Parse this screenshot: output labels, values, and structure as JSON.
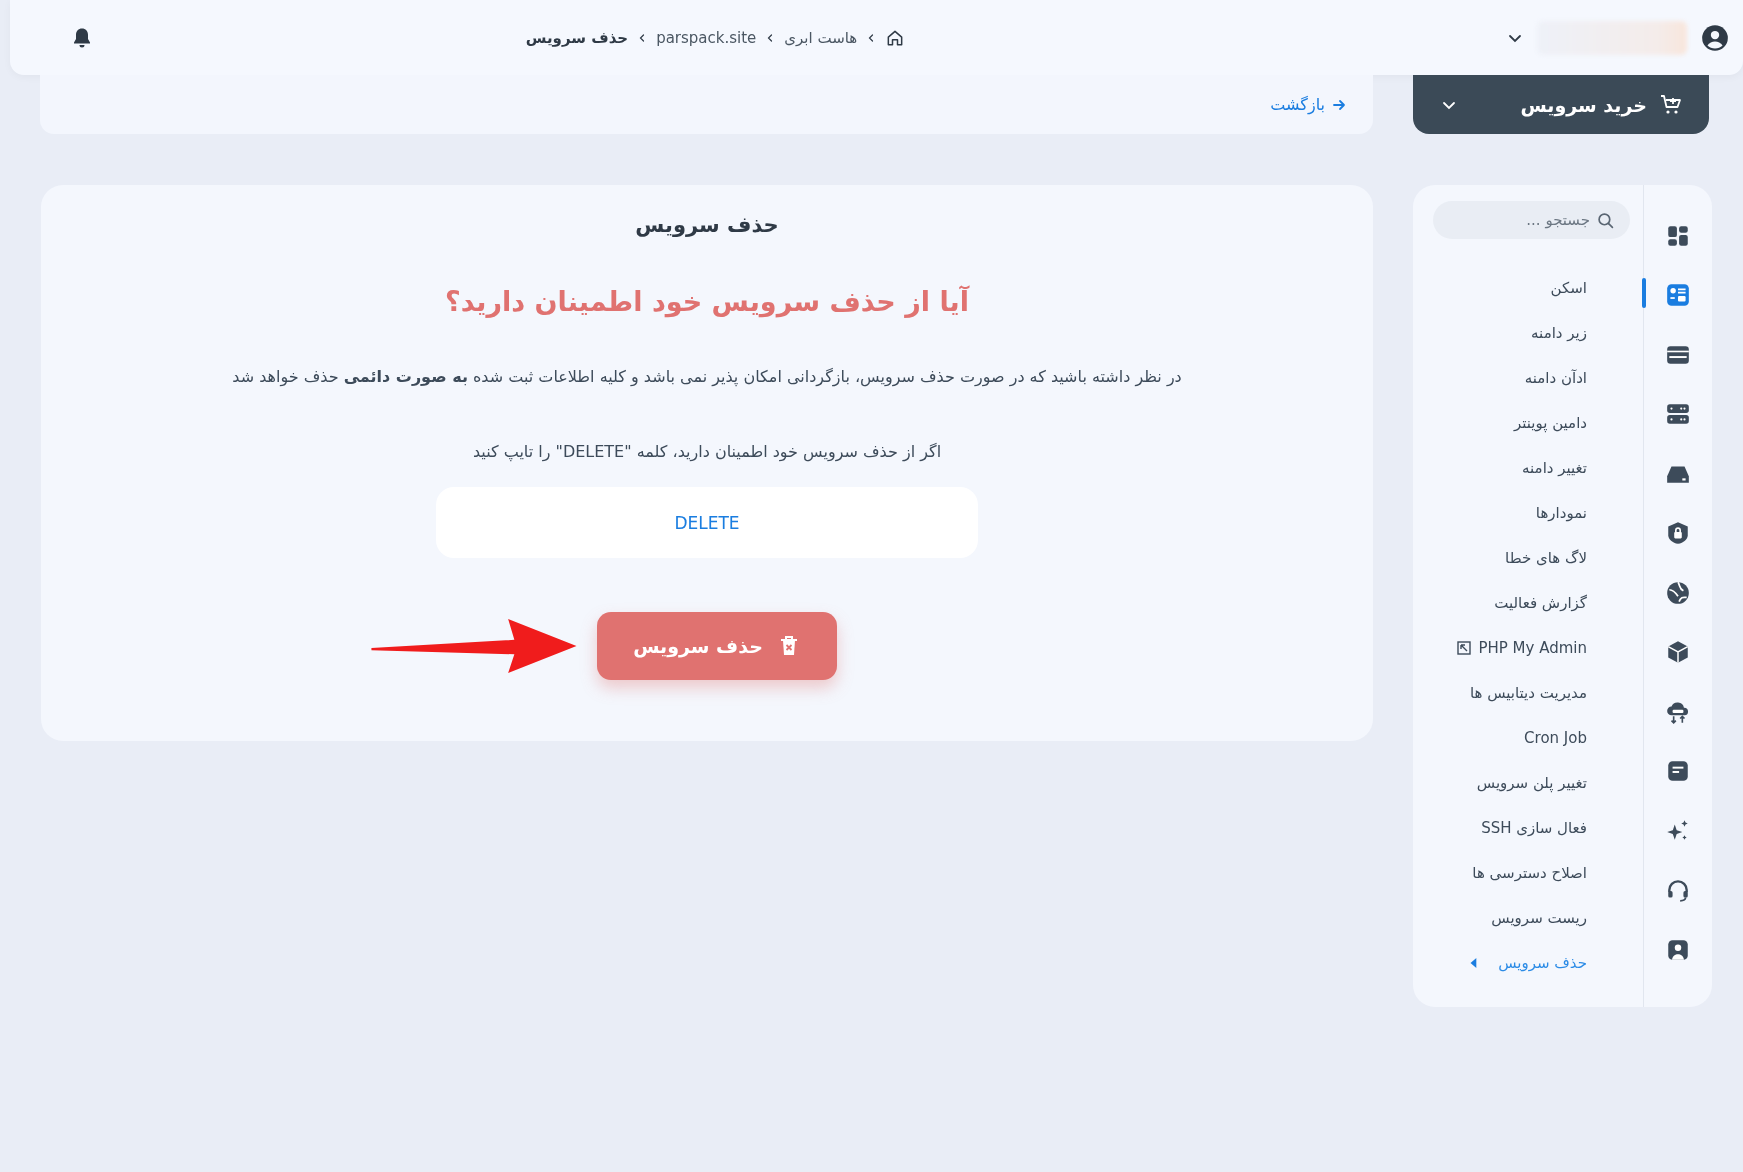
{
  "top_bar": {
    "breadcrumb": [
      {
        "kind": "home"
      },
      {
        "kind": "crumb",
        "label": "هاست ابری"
      },
      {
        "kind": "crumb",
        "label": "parspack.site"
      },
      {
        "kind": "current",
        "label": "حذف سرویس"
      }
    ]
  },
  "buy_button": {
    "label": "خرید سرویس"
  },
  "back_link": {
    "label": "بازگشت"
  },
  "sidebar": {
    "search": {
      "placeholder": "جستجو ..."
    },
    "icons": [
      {
        "selected": false
      },
      {
        "selected": true
      },
      {
        "selected": false
      },
      {
        "selected": false
      },
      {
        "selected": false
      },
      {
        "selected": false
      },
      {
        "selected": false
      },
      {
        "selected": false
      },
      {
        "selected": false
      },
      {
        "selected": false
      },
      {
        "selected": false
      },
      {
        "selected": false
      },
      {
        "selected": false
      }
    ],
    "items": [
      {
        "label": "اسکن",
        "kind": "link",
        "selected": false
      },
      {
        "label": "زیر دامنه",
        "kind": "link",
        "selected": false
      },
      {
        "label": "ادآن دامنه",
        "kind": "link",
        "selected": false
      },
      {
        "label": "دامین پوینتر",
        "kind": "link",
        "selected": false
      },
      {
        "label": "تغییر دامنه",
        "kind": "link",
        "selected": false
      },
      {
        "label": "نمودارها",
        "kind": "link",
        "selected": false
      },
      {
        "label": "لاگ های خطا",
        "kind": "link",
        "selected": false
      },
      {
        "label": "گزارش فعالیت",
        "kind": "link",
        "selected": false
      },
      {
        "label": "PHP My Admin",
        "kind": "external",
        "selected": false
      },
      {
        "label": "مدیریت دیتابیس ها",
        "kind": "link",
        "selected": false
      },
      {
        "label": "Cron Job",
        "kind": "link",
        "selected": false
      },
      {
        "label": "تغییر پلن سرویس",
        "kind": "link",
        "selected": false
      },
      {
        "label": "فعال سازی SSH",
        "kind": "link",
        "selected": false
      },
      {
        "label": "اصلاح دسترسی ها",
        "kind": "link",
        "selected": false
      },
      {
        "label": "ریست سرویس",
        "kind": "link",
        "selected": false
      },
      {
        "label": "حذف سرویس",
        "kind": "link",
        "selected": true
      }
    ]
  },
  "card": {
    "title": "حذف سرویس",
    "question": "آیا از حذف سرویس خود اطمینان دارید؟",
    "warning": "در نظر داشته باشید که در صورت حذف سرویس، بازگردانی امکان پذیر نمی باشد و کلیه اطلاعات ثبت شده **به صورت دائمی** حذف خواهد شد",
    "instruction": "اگر از حذف سرویس خود اطمینان دارید، کلمه \"DELETE\" را تایپ کنید",
    "confirm_field": {
      "value": "DELETE"
    },
    "delete_button": {
      "label": "حذف سرویس"
    }
  }
}
